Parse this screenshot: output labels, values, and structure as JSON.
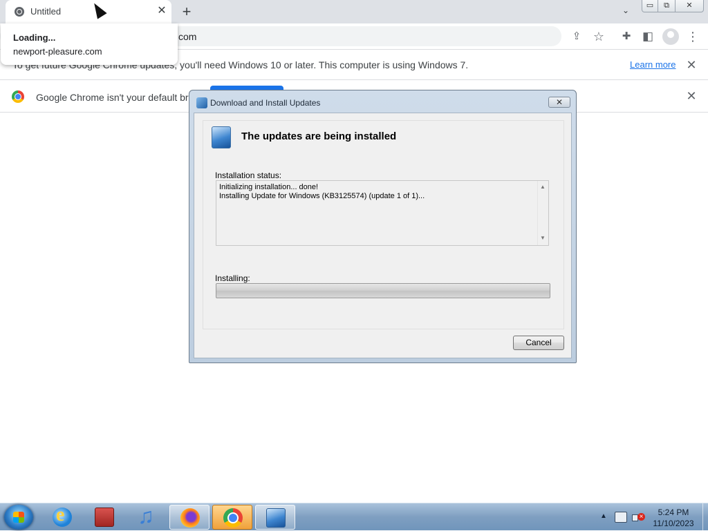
{
  "browser": {
    "tab": {
      "title": "Untitled",
      "close_glyph": "✕",
      "favicon": "globe-icon"
    },
    "new_tab_glyph": "+",
    "tab_search_glyph": "⌄",
    "window_controls": {
      "minimize": "▭",
      "maximize": "⧉",
      "close": "✕"
    },
    "omnibox_text": "com",
    "toolbar_icons": {
      "share": "⇪",
      "bookmark": "☆",
      "extensions": "✚",
      "side_panel": "◧",
      "menu": "⋮"
    }
  },
  "loading_popup": {
    "title": "Loading...",
    "url": "newport-pleasure.com"
  },
  "infobar_windows": {
    "text": "To get future Google Chrome updates, you'll need Windows 10 or later. This computer is using Windows 7.",
    "learn_more": "Learn more",
    "close_glyph": "✕"
  },
  "infobar_default_browser": {
    "text": "Google Chrome isn't your default brow",
    "close_glyph": "✕"
  },
  "dialog": {
    "title": "Download and Install Updates",
    "close_glyph": "✕",
    "heading": "The updates are being installed",
    "status_label": "Installation status:",
    "status_lines": [
      "Initializing installation... done!",
      "Installing Update for Windows (KB3125574) (update 1 of 1)..."
    ],
    "scroll_up": "▲",
    "scroll_down": "▼",
    "installing_label": "Installing:",
    "progress_fraction": 0,
    "cancel_label": "Cancel"
  },
  "taskbar": {
    "apps": [
      "internet-explorer",
      "archive",
      "itunes",
      "firefox",
      "chrome",
      "windows-update"
    ],
    "tray_arrow": "▲",
    "time": "5:24 PM",
    "date": "11/10/2023"
  }
}
